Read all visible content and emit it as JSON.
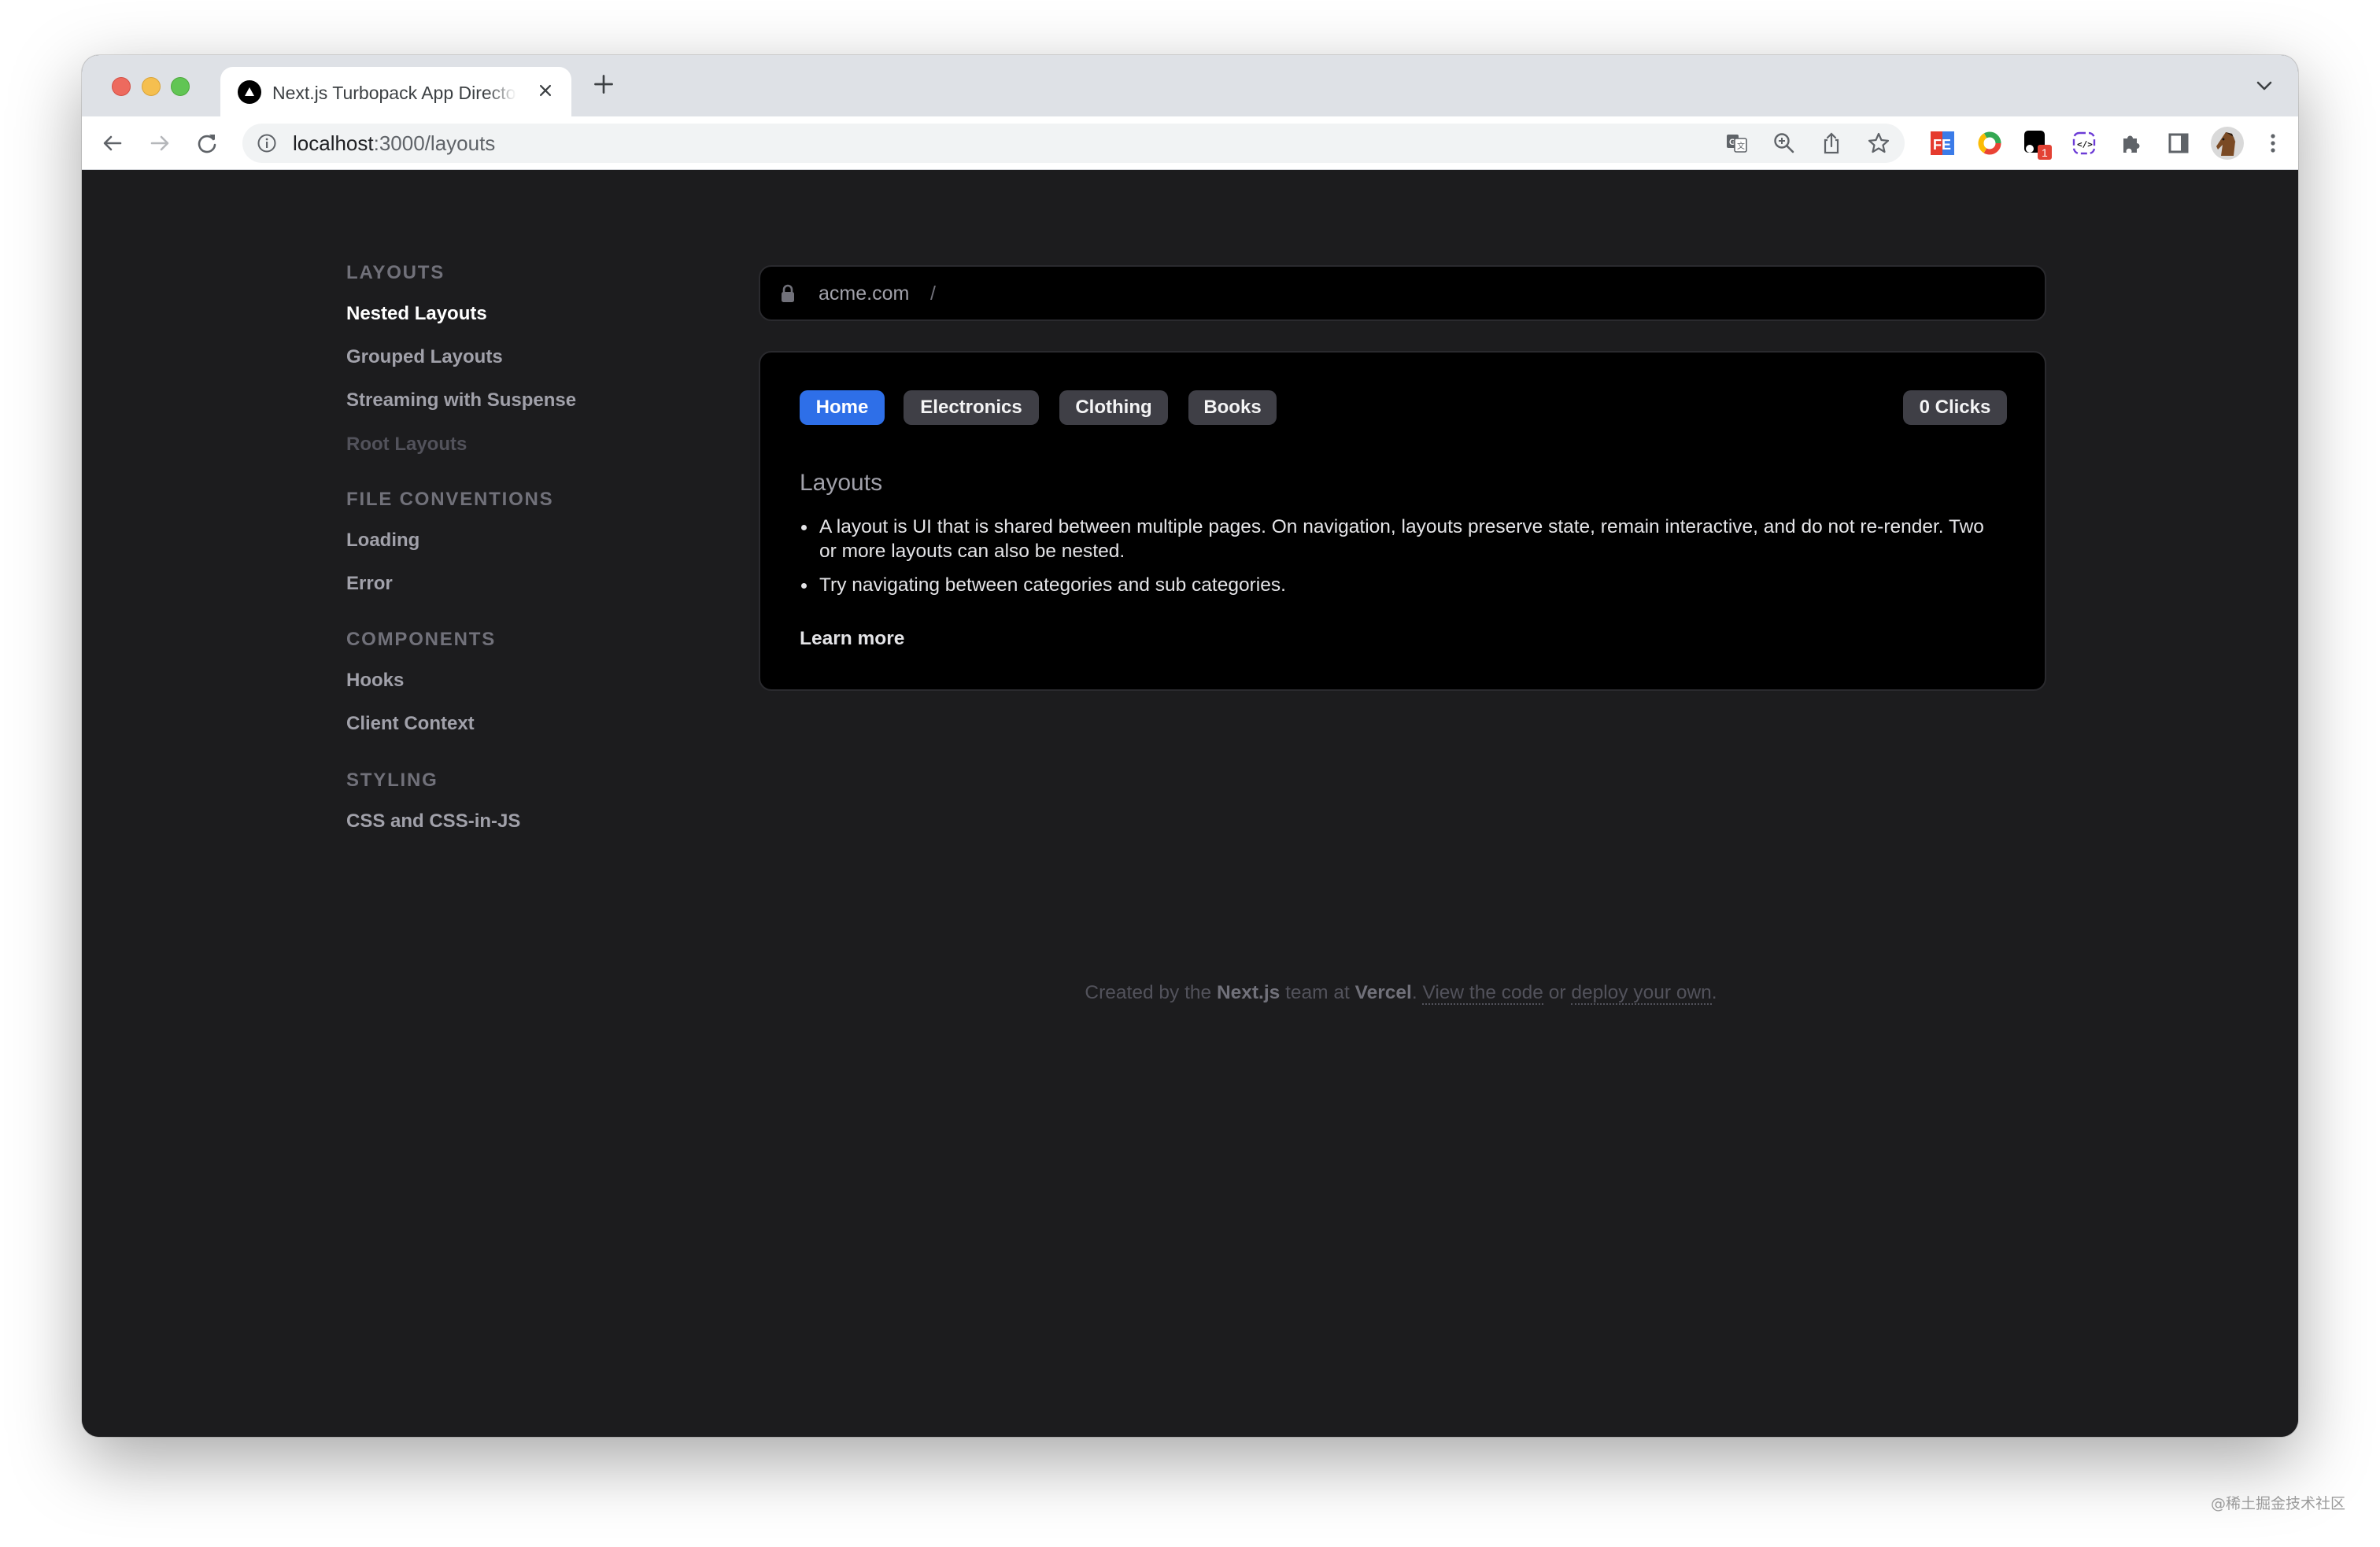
{
  "browser": {
    "tab": {
      "title": "Next.js Turbopack App Directory Playground",
      "favicon": "nextjs-triangle-icon"
    },
    "new_tab_label": "+",
    "omnibox": {
      "host": "localhost",
      "path": ":3000/layouts"
    },
    "toolbar_icons": [
      "back-icon",
      "forward-icon",
      "reload-icon",
      "site-info-icon",
      "translate-icon",
      "zoom-icon",
      "share-icon",
      "bookmark-star-icon"
    ],
    "extensions": [
      {
        "name": "fe-helper-extension"
      },
      {
        "name": "chrome-color-extension"
      },
      {
        "name": "extension-with-badge",
        "badge": "1"
      },
      {
        "name": "code-inspector-extension"
      },
      {
        "name": "extensions-puzzle-icon"
      },
      {
        "name": "side-panel-icon"
      },
      {
        "name": "profile-avatar"
      },
      {
        "name": "more-menu-icon"
      }
    ]
  },
  "sidebar": {
    "sections": [
      {
        "title": "Layouts",
        "items": [
          {
            "label": "Nested Layouts",
            "state": "active"
          },
          {
            "label": "Grouped Layouts",
            "state": "normal"
          },
          {
            "label": "Streaming with Suspense",
            "state": "normal"
          },
          {
            "label": "Root Layouts",
            "state": "disabled"
          }
        ]
      },
      {
        "title": "File Conventions",
        "items": [
          {
            "label": "Loading",
            "state": "normal"
          },
          {
            "label": "Error",
            "state": "normal"
          }
        ]
      },
      {
        "title": "Components",
        "items": [
          {
            "label": "Hooks",
            "state": "normal"
          },
          {
            "label": "Client Context",
            "state": "normal"
          }
        ]
      },
      {
        "title": "Styling",
        "items": [
          {
            "label": "CSS and CSS-in-JS",
            "state": "normal"
          }
        ]
      }
    ]
  },
  "address_bar": {
    "domain": "acme.com",
    "separator": "/"
  },
  "card": {
    "categories": [
      {
        "label": "Home",
        "active": true
      },
      {
        "label": "Electronics",
        "active": false
      },
      {
        "label": "Clothing",
        "active": false
      },
      {
        "label": "Books",
        "active": false
      }
    ],
    "clicks_label": "0 Clicks",
    "heading": "Layouts",
    "bullets": [
      "A layout is UI that is shared between multiple pages. On navigation, layouts preserve state, remain interactive, and do not re-render. Two or more layouts can also be nested.",
      "Try navigating between categories and sub categories."
    ],
    "learn_more": "Learn more"
  },
  "footer": {
    "prefix": "Created by the ",
    "brand1": "Next.js",
    "middle": " team at ",
    "brand2": "Vercel",
    "sep": ". ",
    "link1": "View the code",
    "or": " or ",
    "link2": "deploy your own",
    "end": "."
  },
  "colors": {
    "page_bg": "#1c1c1e",
    "card_bg": "#000000",
    "accent_blue": "#2e6fe8",
    "button_gray": "#3f3f46"
  },
  "watermark": "@稀土掘金技术社区"
}
